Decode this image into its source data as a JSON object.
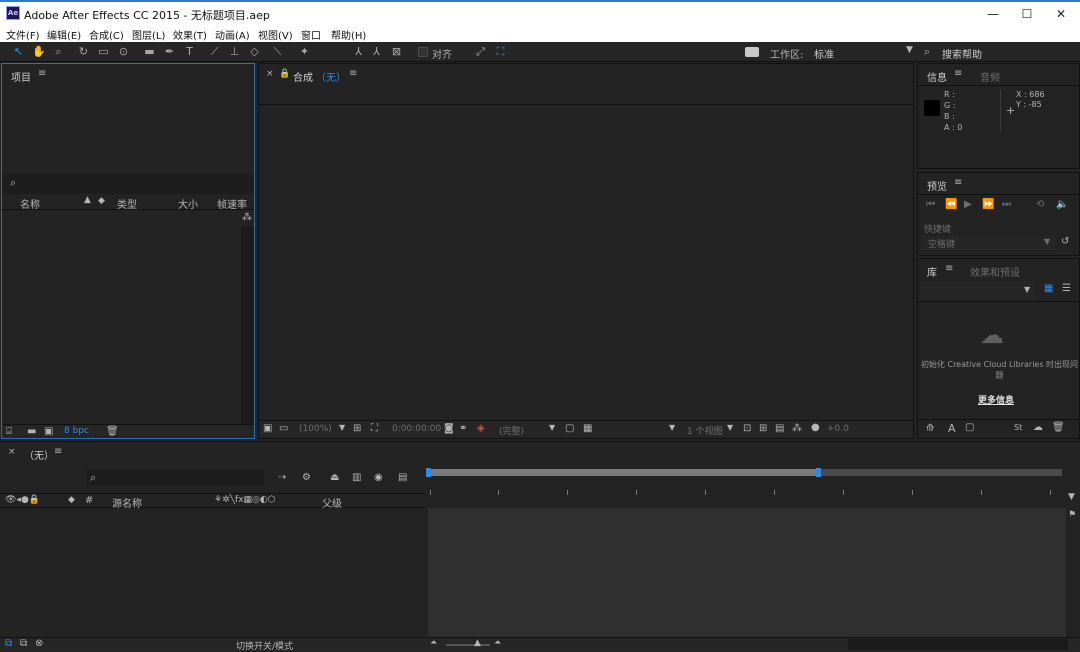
{
  "window": {
    "title": "Adobe After Effects CC 2015 - 无标题项目.aep",
    "logo": "Ae",
    "minimize": "—",
    "maximize": "☐",
    "close": "✕"
  },
  "menu": [
    {
      "label": "文件(F)"
    },
    {
      "label": "编辑(E)"
    },
    {
      "label": "合成(C)"
    },
    {
      "label": "图层(L)"
    },
    {
      "label": "效果(T)"
    },
    {
      "label": "动画(A)"
    },
    {
      "label": "视图(V)"
    },
    {
      "label": "窗口"
    },
    {
      "label": "帮助(H)"
    }
  ],
  "toolbar": {
    "snap_label": "对齐",
    "workspace_label": "工作区:",
    "workspace_value": "标准",
    "search_help": "搜索帮助"
  },
  "project": {
    "tab": "项目",
    "columns": {
      "name": "名称",
      "type": "类型",
      "size": "大小",
      "fps": "帧速率"
    },
    "bpc": "8 bpc"
  },
  "composition": {
    "tab_label": "合成",
    "tab_value": "（无）",
    "zoom": "(100%)",
    "timecode": "0:00:00:00",
    "resolution": "(完整)",
    "views": "1 个视图",
    "exposure": "+0.0"
  },
  "info": {
    "tab": "信息",
    "tab2": "音频",
    "r": "R :",
    "g": "G :",
    "b": "B :",
    "a": "A : 0",
    "x": "X : 686",
    "y": "Y : -85"
  },
  "preview": {
    "tab": "预览",
    "shortcut_label": "快捷键",
    "shortcut_value": "空格键"
  },
  "library": {
    "tab": "库",
    "tab2": "效果和预设",
    "message": "初始化 Creative Cloud Libraries 时出现问题",
    "more_info": "更多信息"
  },
  "timeline": {
    "tab": "（无）",
    "col_source": "源名称",
    "col_parent": "父级",
    "col_hash": "#",
    "footer_toggle": "切换开关/模式"
  }
}
